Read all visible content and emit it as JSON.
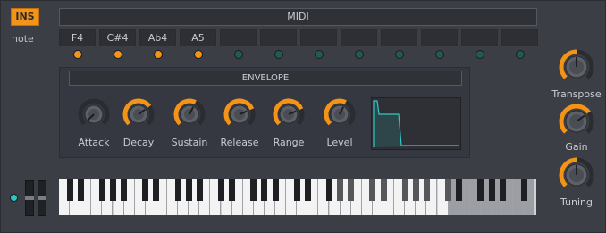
{
  "header": {
    "ins_label": "INS",
    "midi_label": "MIDI"
  },
  "notes": {
    "label": "note",
    "slots": [
      "F4",
      "C#4",
      "Ab4",
      "A5",
      "",
      "",
      "",
      "",
      "",
      "",
      "",
      ""
    ],
    "active": [
      true,
      true,
      true,
      true,
      false,
      false,
      false,
      false,
      false,
      false,
      false,
      false
    ]
  },
  "envelope": {
    "title": "ENVELOPE",
    "knobs": [
      {
        "label": "Attack",
        "value": 0.0
      },
      {
        "label": "Decay",
        "value": 0.7
      },
      {
        "label": "Sustain",
        "value": 0.6
      },
      {
        "label": "Release",
        "value": 0.75
      },
      {
        "label": "Range",
        "value": 0.75
      },
      {
        "label": "Level",
        "value": 0.6
      }
    ]
  },
  "side_knobs": [
    {
      "label": "Transpose",
      "value": 0.5
    },
    {
      "label": "Gain",
      "value": 0.7
    },
    {
      "label": "Tuning",
      "value": 0.5
    }
  ],
  "colors": {
    "accent": "#f39419",
    "graph_line": "#2fc9c7",
    "led": "#27c9c7"
  }
}
